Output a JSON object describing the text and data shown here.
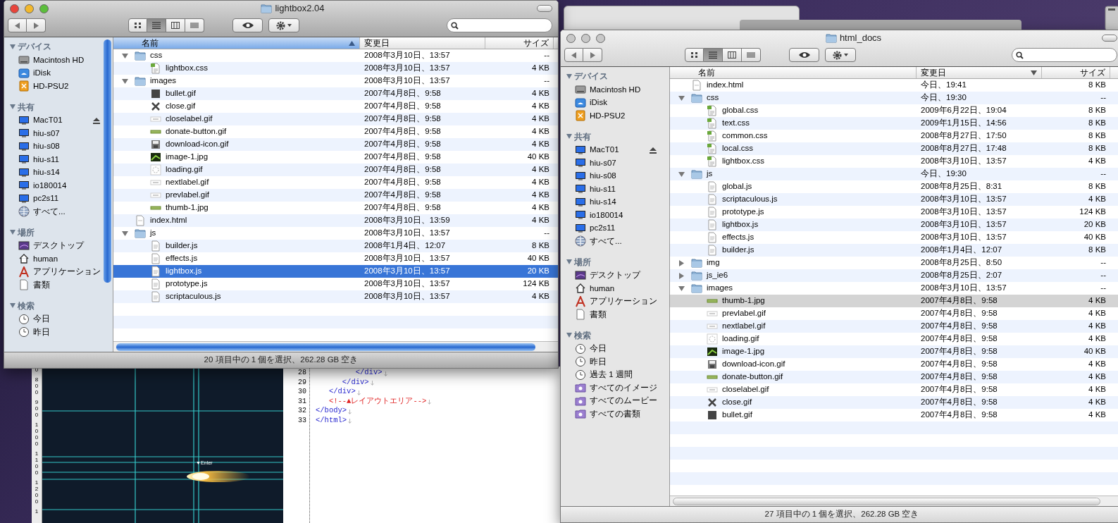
{
  "windows": [
    {
      "title": "lightbox2.04",
      "active": true,
      "sidebar": [
        {
          "heading": "デバイス",
          "items": [
            {
              "label": "Macintosh HD",
              "kind": "drive",
              "eject": false
            },
            {
              "label": "iDisk",
              "kind": "idisk",
              "eject": false
            },
            {
              "label": "HD-PSU2",
              "kind": "external",
              "eject": false
            }
          ]
        },
        {
          "heading": "共有",
          "items": [
            {
              "label": "MacT01",
              "kind": "computer",
              "eject": true
            },
            {
              "label": "hiu-s07",
              "kind": "computer",
              "eject": false
            },
            {
              "label": "hiu-s08",
              "kind": "computer",
              "eject": false
            },
            {
              "label": "hiu-s11",
              "kind": "computer",
              "eject": false
            },
            {
              "label": "hiu-s14",
              "kind": "computer",
              "eject": false
            },
            {
              "label": "io180014",
              "kind": "computer",
              "eject": false
            },
            {
              "label": "pc2s11",
              "kind": "computer",
              "eject": false
            },
            {
              "label": "すべて...",
              "kind": "network",
              "eject": false
            }
          ]
        },
        {
          "heading": "場所",
          "items": [
            {
              "label": "デスクトップ",
              "kind": "desktop",
              "eject": false
            },
            {
              "label": "human",
              "kind": "home",
              "eject": false
            },
            {
              "label": "アプリケーション",
              "kind": "apps",
              "eject": false
            },
            {
              "label": "書類",
              "kind": "docs",
              "eject": false
            }
          ]
        },
        {
          "heading": "検索",
          "items": [
            {
              "label": "今日",
              "kind": "clock",
              "eject": false
            },
            {
              "label": "昨日",
              "kind": "clock",
              "eject": false
            }
          ]
        }
      ],
      "sort_descending": false,
      "columns": [
        {
          "label": "名前",
          "sorted": true
        },
        {
          "label": "変更日",
          "sorted": false
        },
        {
          "label": "サイズ",
          "sorted": false
        }
      ],
      "rows": [
        {
          "name": "css",
          "date": "2008年3月10日、13:57",
          "size": "--",
          "kind": "folder",
          "expanded": true,
          "selected": false,
          "children": [
            {
              "name": "lightbox.css",
              "date": "2008年3月10日、13:57",
              "size": "4 KB",
              "kind": "css",
              "selected": false
            }
          ]
        },
        {
          "name": "images",
          "date": "2008年3月10日、13:57",
          "size": "--",
          "kind": "folder",
          "expanded": true,
          "selected": false,
          "children": [
            {
              "name": "bullet.gif",
              "date": "2007年4月8日、9:58",
              "size": "4 KB",
              "kind": "image-dark",
              "selected": false
            },
            {
              "name": "close.gif",
              "date": "2007年4月8日、9:58",
              "size": "4 KB",
              "kind": "image-x",
              "selected": false
            },
            {
              "name": "closelabel.gif",
              "date": "2007年4月8日、9:58",
              "size": "4 KB",
              "kind": "image-label",
              "selected": false
            },
            {
              "name": "donate-button.gif",
              "date": "2007年4月8日、9:58",
              "size": "4 KB",
              "kind": "image-line",
              "selected": false
            },
            {
              "name": "download-icon.gif",
              "date": "2007年4月8日、9:58",
              "size": "4 KB",
              "kind": "download",
              "selected": false
            },
            {
              "name": "image-1.jpg",
              "date": "2007年4月8日、9:58",
              "size": "40 KB",
              "kind": "image-photo",
              "selected": false
            },
            {
              "name": "loading.gif",
              "date": "2007年4月8日、9:58",
              "size": "4 KB",
              "kind": "image-spinner",
              "selected": false
            },
            {
              "name": "nextlabel.gif",
              "date": "2007年4月8日、9:58",
              "size": "4 KB",
              "kind": "image-label",
              "selected": false
            },
            {
              "name": "prevlabel.gif",
              "date": "2007年4月8日、9:58",
              "size": "4 KB",
              "kind": "image-label",
              "selected": false
            },
            {
              "name": "thumb-1.jpg",
              "date": "2007年4月8日、9:58",
              "size": "4 KB",
              "kind": "image-line",
              "selected": false
            }
          ]
        },
        {
          "name": "index.html",
          "date": "2008年3月10日、13:59",
          "size": "4 KB",
          "kind": "html",
          "selected": false
        },
        {
          "name": "js",
          "date": "2008年3月10日、13:57",
          "size": "--",
          "kind": "folder",
          "expanded": true,
          "selected": false,
          "children": [
            {
              "name": "builder.js",
              "date": "2008年1月4日、12:07",
              "size": "8 KB",
              "kind": "js",
              "selected": false
            },
            {
              "name": "effects.js",
              "date": "2008年3月10日、13:57",
              "size": "40 KB",
              "kind": "js",
              "selected": false
            },
            {
              "name": "lightbox.js",
              "date": "2008年3月10日、13:57",
              "size": "20 KB",
              "kind": "js",
              "selected": true
            },
            {
              "name": "prototype.js",
              "date": "2008年3月10日、13:57",
              "size": "124 KB",
              "kind": "js",
              "selected": false
            },
            {
              "name": "scriptaculous.js",
              "date": "2008年3月10日、13:57",
              "size": "4 KB",
              "kind": "js",
              "selected": false
            }
          ]
        }
      ],
      "status": "20 項目中の 1 個を選択、262.28 GB 空き"
    },
    {
      "title": "html_docs",
      "active": false,
      "sidebar": [
        {
          "heading": "デバイス",
          "items": [
            {
              "label": "Macintosh HD",
              "kind": "drive",
              "eject": false
            },
            {
              "label": "iDisk",
              "kind": "idisk",
              "eject": false
            },
            {
              "label": "HD-PSU2",
              "kind": "external",
              "eject": false
            }
          ]
        },
        {
          "heading": "共有",
          "items": [
            {
              "label": "MacT01",
              "kind": "computer",
              "eject": true
            },
            {
              "label": "hiu-s07",
              "kind": "computer",
              "eject": false
            },
            {
              "label": "hiu-s08",
              "kind": "computer",
              "eject": false
            },
            {
              "label": "hiu-s11",
              "kind": "computer",
              "eject": false
            },
            {
              "label": "hiu-s14",
              "kind": "computer",
              "eject": false
            },
            {
              "label": "io180014",
              "kind": "computer",
              "eject": false
            },
            {
              "label": "pc2s11",
              "kind": "computer",
              "eject": false
            },
            {
              "label": "すべて...",
              "kind": "network",
              "eject": false
            }
          ]
        },
        {
          "heading": "場所",
          "items": [
            {
              "label": "デスクトップ",
              "kind": "desktop",
              "eject": false
            },
            {
              "label": "human",
              "kind": "home",
              "eject": false
            },
            {
              "label": "アプリケーション",
              "kind": "apps",
              "eject": false
            },
            {
              "label": "書類",
              "kind": "docs",
              "eject": false
            }
          ]
        },
        {
          "heading": "検索",
          "items": [
            {
              "label": "今日",
              "kind": "clock",
              "eject": false
            },
            {
              "label": "昨日",
              "kind": "clock",
              "eject": false
            },
            {
              "label": "過去 1 週間",
              "kind": "clock",
              "eject": false
            },
            {
              "label": "すべてのイメージ",
              "kind": "smart",
              "eject": false
            },
            {
              "label": "すべてのムービー",
              "kind": "smart",
              "eject": false
            },
            {
              "label": "すべての書類",
              "kind": "smart",
              "eject": false
            }
          ]
        }
      ],
      "sort_descending": true,
      "columns": [
        {
          "label": "名前",
          "sorted": false
        },
        {
          "label": "変更日",
          "sorted": true
        },
        {
          "label": "サイズ",
          "sorted": false
        }
      ],
      "rows": [
        {
          "name": "index.html",
          "date": "今日、19:41",
          "size": "8 KB",
          "kind": "html",
          "selected": false
        },
        {
          "name": "css",
          "date": "今日、19:30",
          "size": "--",
          "kind": "folder",
          "expanded": true,
          "selected": false,
          "children": [
            {
              "name": "global.css",
              "date": "2009年6月22日、19:04",
              "size": "8 KB",
              "kind": "css",
              "selected": false
            },
            {
              "name": "text.css",
              "date": "2009年1月15日、14:56",
              "size": "8 KB",
              "kind": "css",
              "selected": false
            },
            {
              "name": "common.css",
              "date": "2008年8月27日、17:50",
              "size": "8 KB",
              "kind": "css",
              "selected": false
            },
            {
              "name": "local.css",
              "date": "2008年8月27日、17:48",
              "size": "8 KB",
              "kind": "css",
              "selected": false
            },
            {
              "name": "lightbox.css",
              "date": "2008年3月10日、13:57",
              "size": "4 KB",
              "kind": "css",
              "selected": false
            }
          ]
        },
        {
          "name": "js",
          "date": "今日、19:30",
          "size": "--",
          "kind": "folder",
          "expanded": true,
          "selected": false,
          "children": [
            {
              "name": "global.js",
              "date": "2008年8月25日、8:31",
              "size": "8 KB",
              "kind": "js",
              "selected": false
            },
            {
              "name": "scriptaculous.js",
              "date": "2008年3月10日、13:57",
              "size": "4 KB",
              "kind": "js",
              "selected": false
            },
            {
              "name": "prototype.js",
              "date": "2008年3月10日、13:57",
              "size": "124 KB",
              "kind": "js",
              "selected": false
            },
            {
              "name": "lightbox.js",
              "date": "2008年3月10日、13:57",
              "size": "20 KB",
              "kind": "js",
              "selected": false
            },
            {
              "name": "effects.js",
              "date": "2008年3月10日、13:57",
              "size": "40 KB",
              "kind": "js",
              "selected": false
            },
            {
              "name": "builder.js",
              "date": "2008年1月4日、12:07",
              "size": "8 KB",
              "kind": "js",
              "selected": false
            }
          ]
        },
        {
          "name": "img",
          "date": "2008年8月25日、8:50",
          "size": "--",
          "kind": "folder",
          "expanded": false,
          "selected": false
        },
        {
          "name": "js_ie6",
          "date": "2008年8月25日、2:07",
          "size": "--",
          "kind": "folder",
          "expanded": false,
          "selected": false
        },
        {
          "name": "images",
          "date": "2008年3月10日、13:57",
          "size": "--",
          "kind": "folder",
          "expanded": true,
          "selected": false,
          "children": [
            {
              "name": "thumb-1.jpg",
              "date": "2007年4月8日、9:58",
              "size": "4 KB",
              "kind": "image-line",
              "selected": true
            },
            {
              "name": "prevlabel.gif",
              "date": "2007年4月8日、9:58",
              "size": "4 KB",
              "kind": "image-label",
              "selected": false
            },
            {
              "name": "nextlabel.gif",
              "date": "2007年4月8日、9:58",
              "size": "4 KB",
              "kind": "image-label",
              "selected": false
            },
            {
              "name": "loading.gif",
              "date": "2007年4月8日、9:58",
              "size": "4 KB",
              "kind": "image-spinner",
              "selected": false
            },
            {
              "name": "image-1.jpg",
              "date": "2007年4月8日、9:58",
              "size": "40 KB",
              "kind": "image-photo",
              "selected": false
            },
            {
              "name": "download-icon.gif",
              "date": "2007年4月8日、9:58",
              "size": "4 KB",
              "kind": "download",
              "selected": false
            },
            {
              "name": "donate-button.gif",
              "date": "2007年4月8日、9:58",
              "size": "4 KB",
              "kind": "image-line",
              "selected": false
            },
            {
              "name": "closelabel.gif",
              "date": "2007年4月8日、9:58",
              "size": "4 KB",
              "kind": "image-label",
              "selected": false
            },
            {
              "name": "close.gif",
              "date": "2007年4月8日、9:58",
              "size": "4 KB",
              "kind": "image-x",
              "selected": false
            },
            {
              "name": "bullet.gif",
              "date": "2007年4月8日、9:58",
              "size": "4 KB",
              "kind": "image-dark",
              "selected": false
            }
          ]
        }
      ],
      "status": "27 項目中の 1 個を選択、262.28 GB 空き"
    }
  ],
  "canvas": {
    "ruler": [
      "0",
      "800",
      "900",
      "1000",
      "1100",
      "1200",
      "1"
    ],
    "marker": "▼Enter"
  },
  "editor": {
    "lines": [
      {
        "number": "28",
        "code": "\t\t\t</div>",
        "kind": "tag"
      },
      {
        "number": "29",
        "code": "\t\t</div>",
        "kind": "tag"
      },
      {
        "number": "30",
        "code": "\t</div>",
        "kind": "tag"
      },
      {
        "number": "31",
        "code": "\t<!--▲レイアウトエリア-->",
        "kind": "comment"
      },
      {
        "number": "32",
        "code": "</body>",
        "kind": "tag"
      },
      {
        "number": "33",
        "code": "</html>",
        "kind": "tag"
      }
    ]
  }
}
